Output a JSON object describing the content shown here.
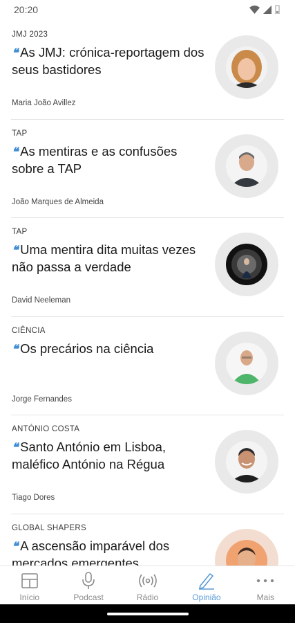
{
  "status_bar": {
    "time": "20:20"
  },
  "articles": [
    {
      "category": "JMJ 2023",
      "quote_icon": "quote-icon",
      "title": "As JMJ: crónica-reportagem dos seus bastidores",
      "author": "Maria João Avillez"
    },
    {
      "category": "TAP",
      "quote_icon": "quote-icon",
      "title": "As mentiras e as confusões sobre a TAP",
      "author": "João Marques de Almeida"
    },
    {
      "category": "TAP",
      "quote_icon": "quote-icon",
      "title": "Uma mentira dita muitas vezes não passa a verdade",
      "author": "David Neeleman"
    },
    {
      "category": "CIÊNCIA",
      "quote_icon": "quote-icon",
      "title": "Os precários na ciência",
      "author": "Jorge Fernandes"
    },
    {
      "category": "ANTÓNIO COSTA",
      "quote_icon": "quote-icon",
      "title": "Santo António em Lisboa, maléfico António na Régua",
      "author": "Tiago Dores"
    },
    {
      "category": "GLOBAL SHAPERS",
      "quote_icon": "quote-icon",
      "title": "A ascensão imparável dos mercados emergentes",
      "author": ""
    }
  ],
  "bottom_nav": {
    "items": [
      {
        "label": "Início",
        "icon": "home-grid-icon"
      },
      {
        "label": "Podcast",
        "icon": "microphone-icon"
      },
      {
        "label": "Rádio",
        "icon": "radio-icon"
      },
      {
        "label": "Opinião",
        "icon": "pen-icon"
      },
      {
        "label": "Mais",
        "icon": "more-dots-icon"
      }
    ],
    "active": "Opinião"
  },
  "colors": {
    "accent": "#3f8ed6",
    "active_nav": "#5b9bd5",
    "divider": "#e3e3e3",
    "avatar_ring": "#e9e9e9"
  }
}
